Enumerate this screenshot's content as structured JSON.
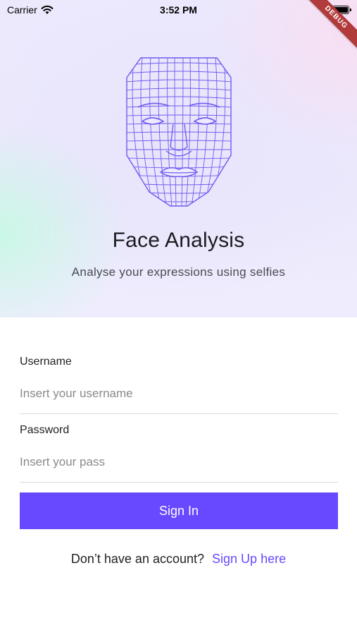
{
  "status_bar": {
    "carrier": "Carrier",
    "time": "3:52 PM",
    "wifi_icon": "wifi-icon",
    "battery_icon": "battery-icon"
  },
  "debug_banner": "DEBUG",
  "hero": {
    "illustration": "face-mesh-icon",
    "title": "Face Analysis",
    "subtitle": "Analyse your expressions using selfies"
  },
  "form": {
    "username": {
      "label": "Username",
      "placeholder": "Insert your username",
      "value": ""
    },
    "password": {
      "label": "Password",
      "placeholder": "Insert your pass",
      "value": ""
    },
    "sign_in_label": "Sign In"
  },
  "signup": {
    "prompt": "Don’t have an account?",
    "link_label": "Sign Up here"
  },
  "colors": {
    "accent": "#6849ff",
    "mesh": "#6f5cf0",
    "debug": "#b13a3a"
  }
}
